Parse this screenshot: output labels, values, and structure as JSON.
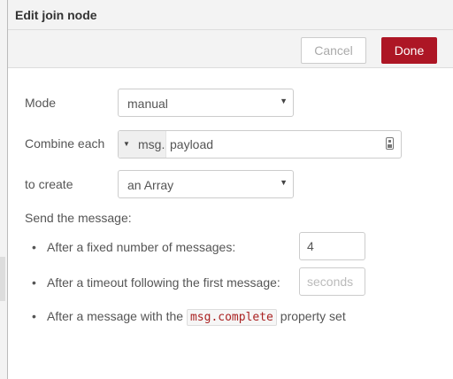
{
  "header": {
    "title": "Edit join node"
  },
  "toolbar": {
    "cancel_label": "Cancel",
    "done_label": "Done"
  },
  "form": {
    "mode": {
      "label": "Mode",
      "value": "manual"
    },
    "combine": {
      "label": "Combine each",
      "type_prefix": "msg.",
      "value": "payload"
    },
    "create": {
      "label": "to create",
      "value": "an Array"
    },
    "send": {
      "label": "Send the message:",
      "count_text": "After a fixed number of messages:",
      "count_value": "4",
      "timeout_text": "After a timeout following the first message:",
      "timeout_placeholder": "seconds",
      "complete_text_before": "After a message with the",
      "complete_code": "msg.complete",
      "complete_text_after": "property set"
    }
  },
  "colors": {
    "done_button": "#ad1625",
    "code_text": "#aa2222"
  }
}
